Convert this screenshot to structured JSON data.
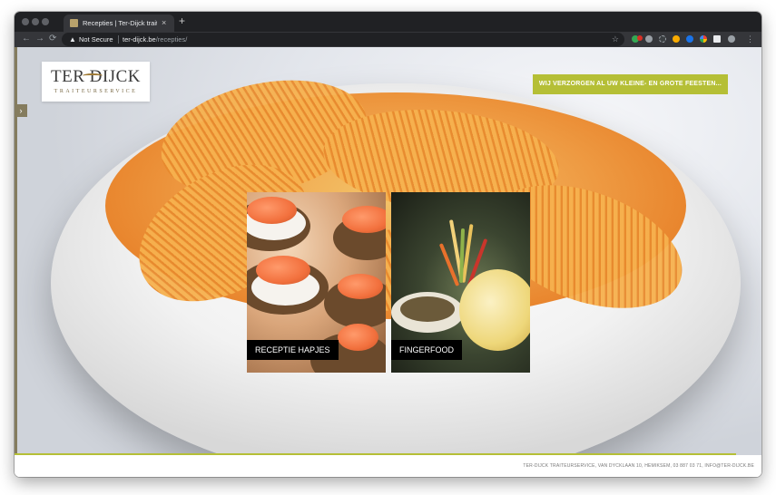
{
  "browser": {
    "tab_title": "Recepties | Ter-Dijck traiteur s",
    "tab_close": "×",
    "new_tab": "+",
    "security_label": "Not Secure",
    "url_host": "ter-dijck.be",
    "url_path": "/recepties/",
    "nav": {
      "back": "←",
      "forward": "→",
      "reload": "⟳"
    }
  },
  "site": {
    "logo_main": "TER DIJCK",
    "logo_sub": "TRAITEURSERVICE",
    "side_toggle": "›",
    "cta_label": "WIJ VERZORGEN AL UW KLEINE- EN GROTE FEESTEN...",
    "tiles": [
      {
        "label": "RECEPTIE HAPJES"
      },
      {
        "label": "FINGERFOOD"
      }
    ],
    "footer_text": "TER-DIJCK TRAITEURSERVICE, VAN DYCKLAAN 10, HEMIKSEM, 03 887 03 71, INFO@TER-DIJCK.BE"
  },
  "colors": {
    "accent": "#b5bf36",
    "brand_gold": "#857c5e",
    "browser_dark": "#202124"
  }
}
